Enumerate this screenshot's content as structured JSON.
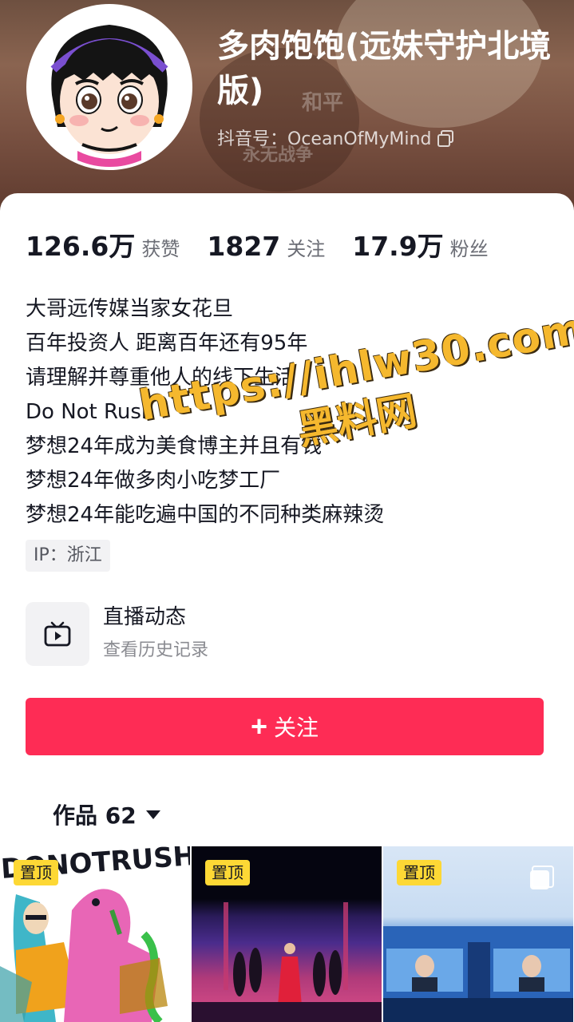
{
  "profile": {
    "nickname": "多肉饱饱(远妹守护北境版)",
    "douyin_id": "抖音号：OceanOfMyMind",
    "header_bg_text_1": "和平",
    "header_bg_text_2": "永无战争"
  },
  "stats": [
    {
      "value": "126.6万",
      "label": "获赞"
    },
    {
      "value": "1827",
      "label": "关注"
    },
    {
      "value": "17.9万",
      "label": "粉丝"
    }
  ],
  "bio": [
    "大哥远传媒当家女花旦",
    "百年投资人 距离百年还有95年",
    "请理解并尊重他人的线下生活",
    "Do Not Rush",
    "梦想24年成为美食博主并且有钱",
    "梦想24年做多肉小吃梦工厂",
    "梦想24年能吃遍中国的不同种类麻辣烫"
  ],
  "ip_location": "IP：浙江",
  "live": {
    "title": "直播动态",
    "subtitle": "查看历史记录",
    "icon": "tv-icon"
  },
  "follow_button": {
    "label": "关注",
    "icon": "plus-icon",
    "color": "#fe2c55"
  },
  "works": {
    "tab_label": "作品 62"
  },
  "videos": [
    {
      "badge": "置顶"
    },
    {
      "badge": "置顶"
    },
    {
      "badge": "置顶"
    }
  ],
  "watermark": {
    "url": "https://ihlw30.com",
    "name": "黑料网"
  }
}
